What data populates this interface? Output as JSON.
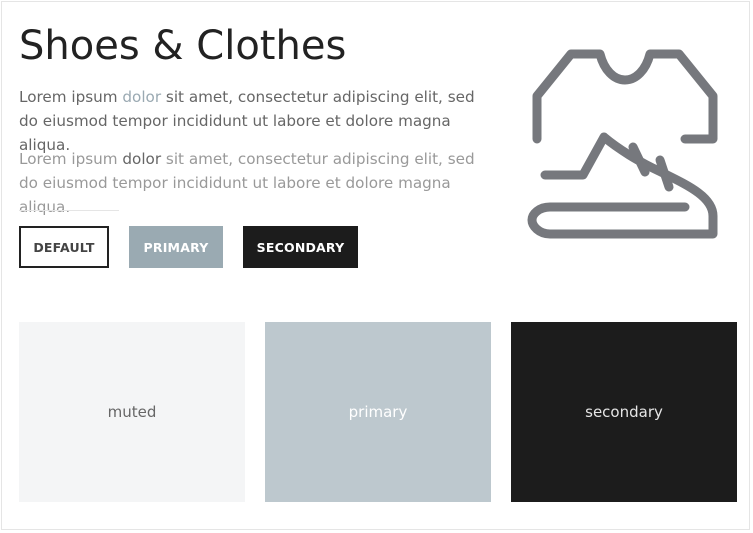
{
  "page": {
    "title": "Shoes & Clothes",
    "paragraph_1": {
      "part1": "Lorem ipsum ",
      "highlight": "dolor",
      "part2": " sit amet, consectetur adipiscing elit, sed do eiusmod tempor incididunt ut labore et dolore magna aliqua."
    },
    "paragraph_2": {
      "part1": "Lorem ipsum ",
      "highlight": "dolor",
      "part2": " sit amet, consectetur adipiscing elit, sed do eiusmod tempor incididunt ut labore et dolore magna aliqua."
    }
  },
  "buttons": {
    "default_label": "DEFAULT",
    "primary_label": "PRIMARY",
    "secondary_label": "SECONDARY"
  },
  "hero_icon": {
    "name": "shoes-and-clothes-icon",
    "color": "#76787d"
  },
  "tiles": {
    "muted_label": "muted",
    "primary_label": "primary",
    "secondary_label": "secondary"
  },
  "colors": {
    "primary": "#9aaab2",
    "primary_tile": "#bdc8ce",
    "secondary": "#1c1c1c",
    "muted": "#f4f5f6",
    "text": "#222222"
  }
}
